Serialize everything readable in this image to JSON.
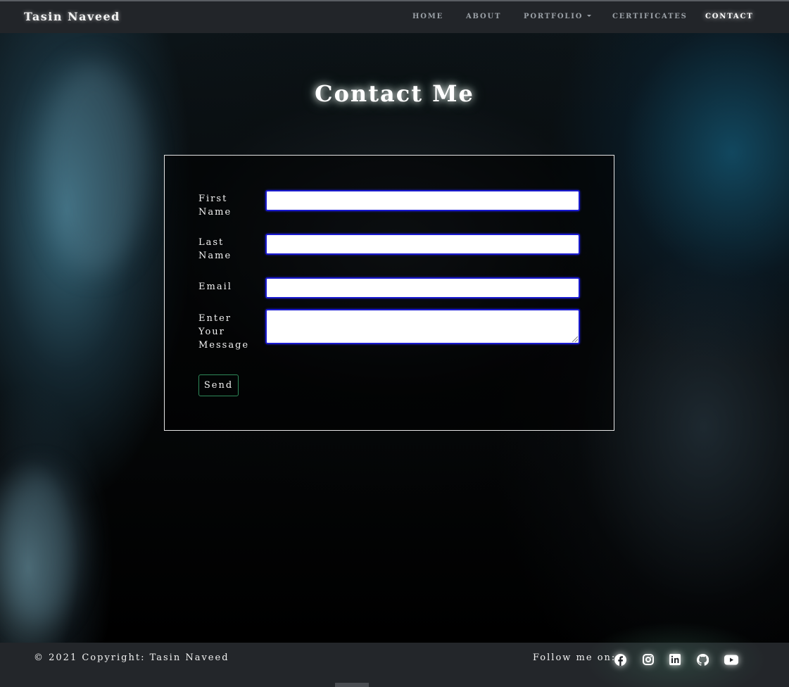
{
  "navbar": {
    "brand": "Tasin Naveed",
    "items": [
      {
        "label": "HOME"
      },
      {
        "label": "ABOUT"
      },
      {
        "label": "PORTFOLIO"
      },
      {
        "label": "CERTIFICATES"
      },
      {
        "label": "CONTACT"
      }
    ],
    "active": "CONTACT"
  },
  "main": {
    "title": "Contact Me"
  },
  "form": {
    "first_name_label": "First Name",
    "last_name_label": "Last Name",
    "email_label": "Email",
    "message_label": "Enter Your Message",
    "first_name_value": "",
    "last_name_value": "",
    "email_value": "",
    "message_value": "",
    "send_label": "Send"
  },
  "footer": {
    "copyright": "© 2021 Copyright: Tasin Naveed",
    "follow_label": "Follow me on:",
    "social_icons": [
      "facebook-icon",
      "instagram-icon",
      "linkedin-icon",
      "github-icon",
      "youtube-icon"
    ]
  },
  "colors": {
    "navbar_bg": "#222529",
    "footer_bg": "#23262a",
    "input_border": "#1a1ad0",
    "send_border": "#2e8a5a"
  }
}
